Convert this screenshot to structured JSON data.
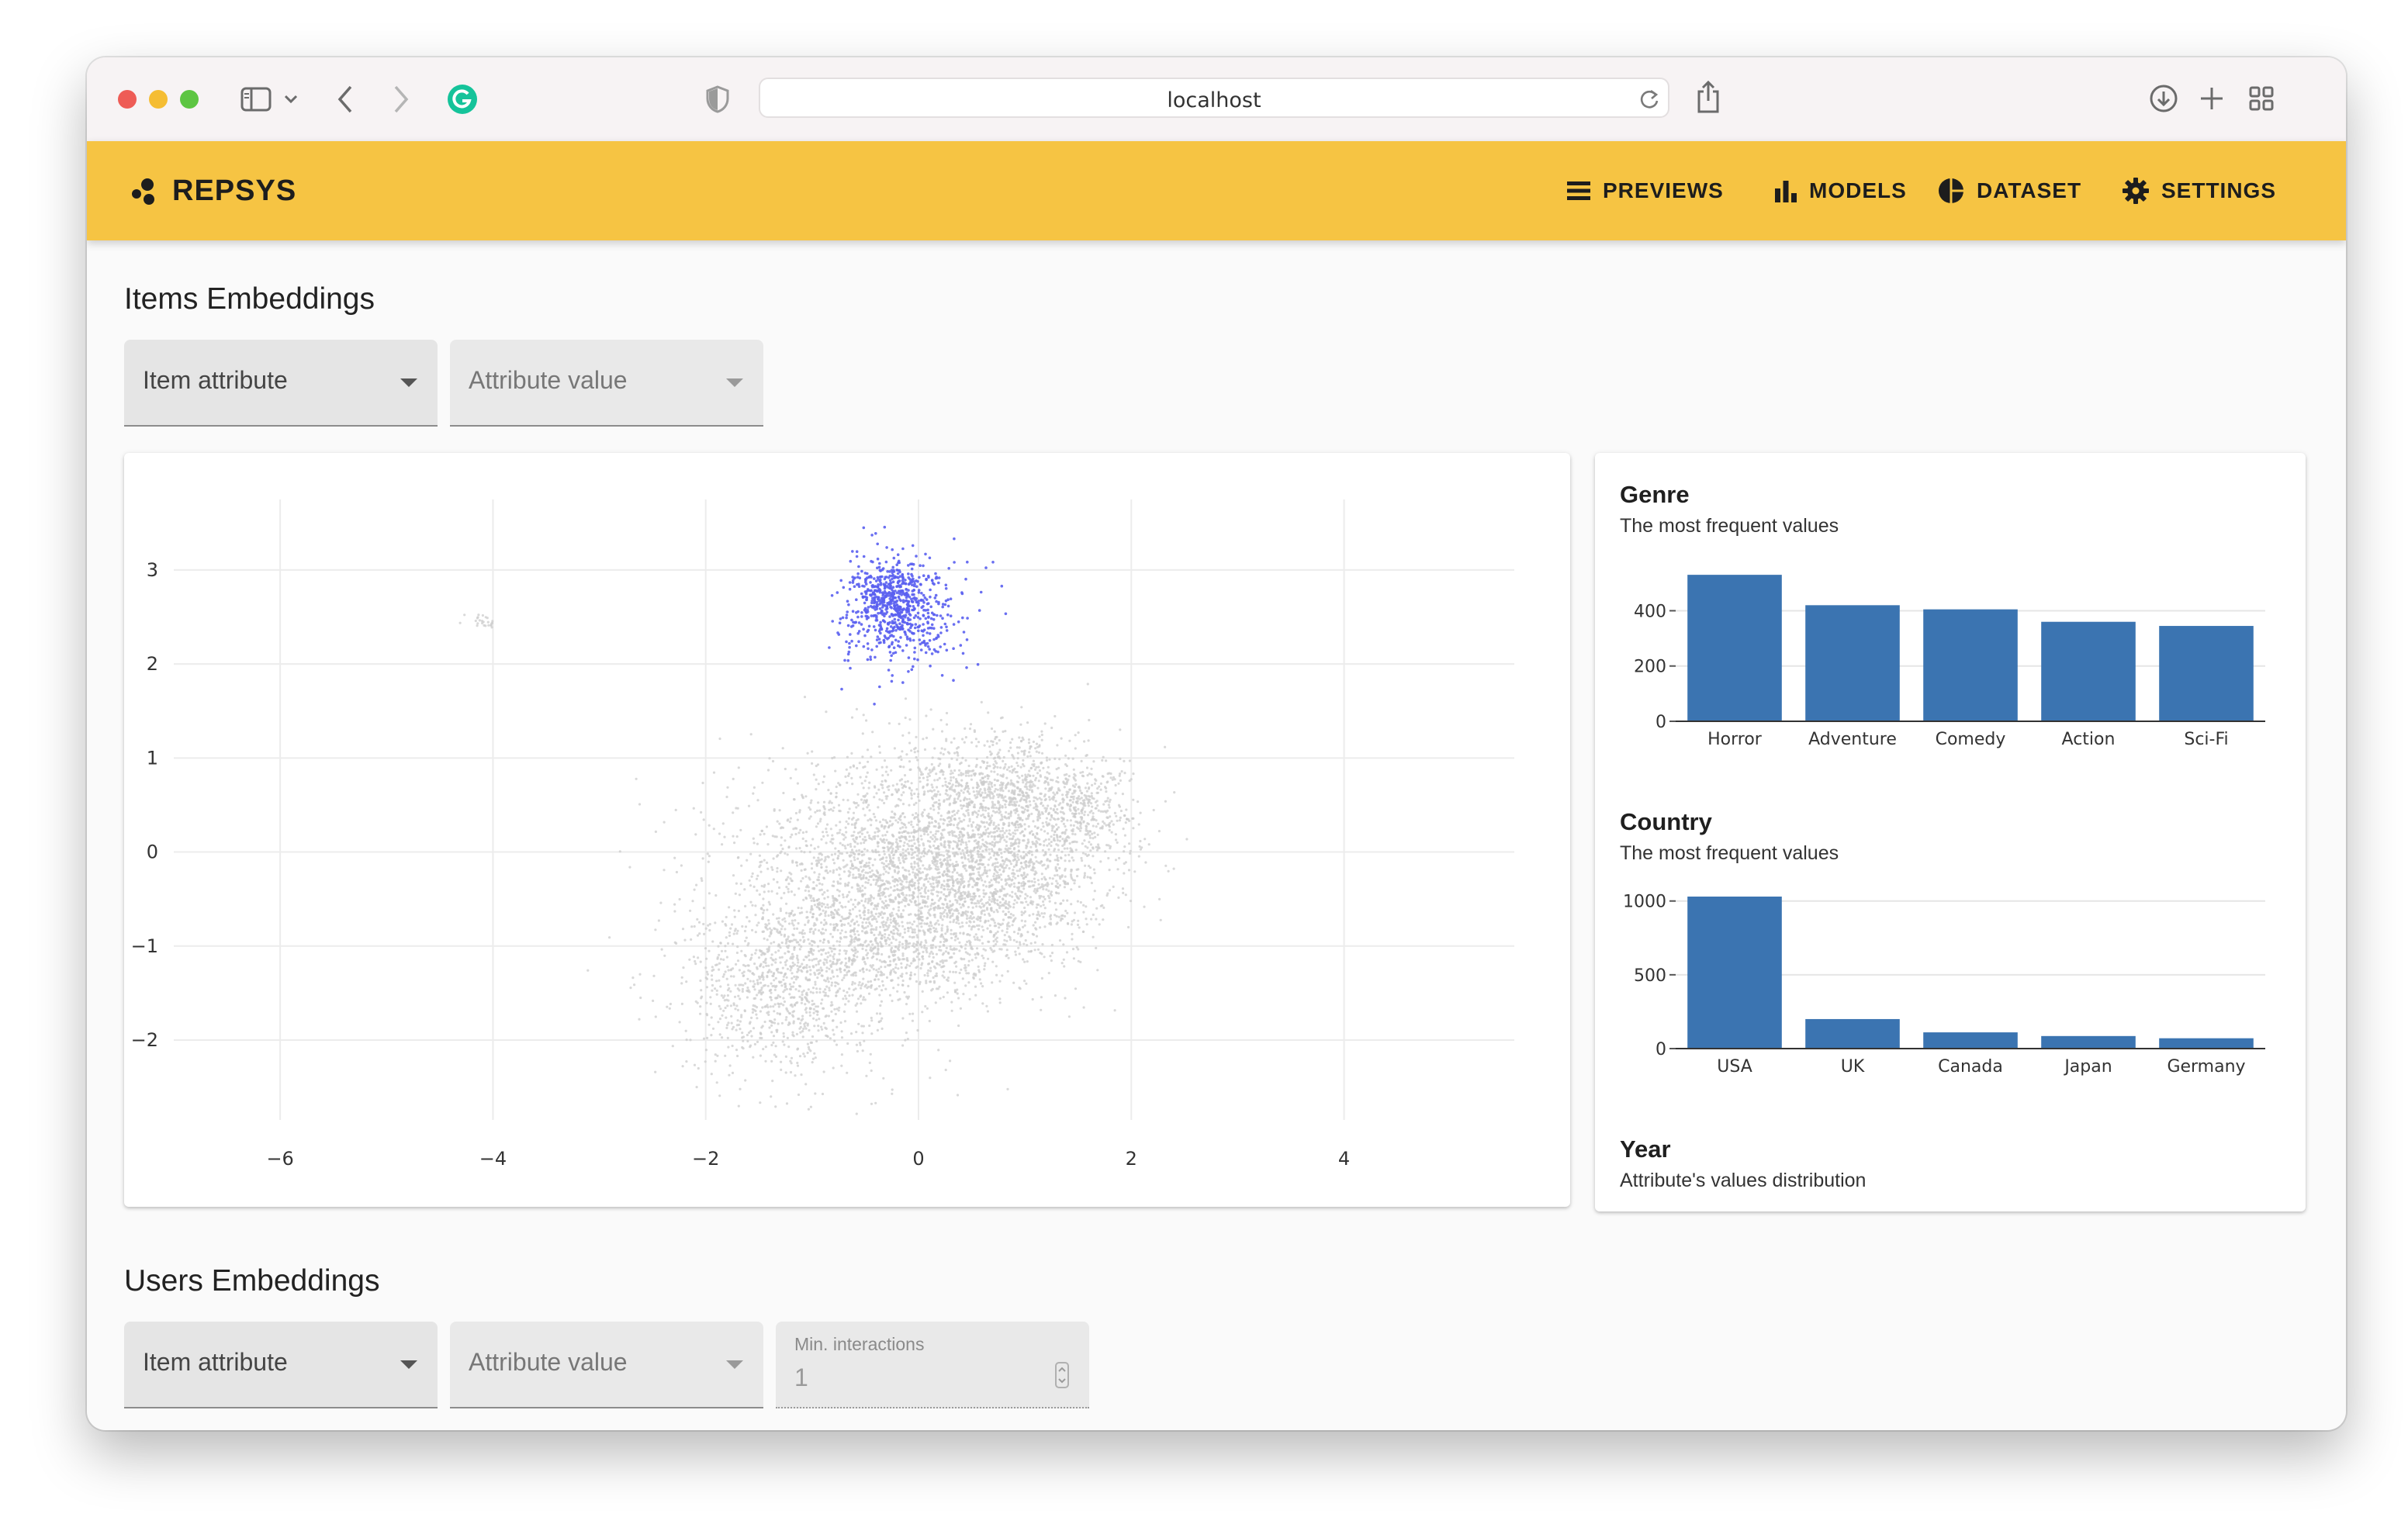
{
  "browser": {
    "url": "localhost"
  },
  "app": {
    "brand": "REPSYS",
    "nav": [
      {
        "label": "PREVIEWS",
        "icon": "list-icon"
      },
      {
        "label": "MODELS",
        "icon": "bar-chart-icon"
      },
      {
        "label": "DATASET",
        "icon": "pie-chart-icon"
      },
      {
        "label": "SETTINGS",
        "icon": "gear-icon"
      }
    ]
  },
  "items_section": {
    "title": "Items Embeddings",
    "select_attribute": "Item attribute",
    "select_value": "Attribute value"
  },
  "users_section": {
    "title": "Users Embeddings",
    "select_attribute": "Item attribute",
    "select_value": "Attribute value",
    "min_interactions_label": "Min. interactions",
    "min_interactions_value": "1"
  },
  "side_panel": {
    "genre_title": "Genre",
    "genre_sub": "The most frequent values",
    "country_title": "Country",
    "country_sub": "The most frequent values",
    "year_title": "Year",
    "year_sub": "Attribute's values distribution"
  },
  "chart_data": [
    {
      "type": "scatter",
      "title": "",
      "xlim": [
        -7,
        5.6
      ],
      "ylim": [
        -2.85,
        3.75
      ],
      "x_ticks": [
        -6,
        -4,
        -2,
        0,
        2,
        4
      ],
      "y_ticks": [
        -2,
        -1,
        0,
        1,
        2,
        3
      ],
      "x_tick_labels": [
        "−6",
        "−4",
        "−2",
        "0",
        "2",
        "4"
      ],
      "y_tick_labels": [
        "−2",
        "−1",
        "0",
        "1",
        "2",
        "3"
      ],
      "grid": true,
      "series": [
        {
          "color": "#cccccc",
          "description_points": "dense cloud roughly x -2.2..2.1, y -2.3..1.4, plus small cluster near (-4.1, 2.45)"
        },
        {
          "color": "#5a5ff0",
          "description_points": "highlighted cluster roughly x -1.0..0.9, y 1.8..3.3 centered near (-0.25, 2.7)"
        }
      ],
      "gray_clusters": [
        {
          "cx": 0.6,
          "cy": -0.1,
          "sx": 0.6,
          "sy": 0.55,
          "n": 2200
        },
        {
          "cx": -0.4,
          "cy": -0.3,
          "sx": 0.75,
          "sy": 0.65,
          "n": 1700
        },
        {
          "cx": -1.3,
          "cy": -1.45,
          "sx": 0.45,
          "sy": 0.45,
          "n": 900
        },
        {
          "cx": 0.8,
          "cy": 0.75,
          "sx": 0.4,
          "sy": 0.3,
          "n": 500
        },
        {
          "cx": 1.55,
          "cy": 0.45,
          "sx": 0.25,
          "sy": 0.25,
          "n": 300
        },
        {
          "cx": -0.2,
          "cy": -1.0,
          "sx": 0.5,
          "sy": 0.3,
          "n": 500
        },
        {
          "cx": -4.1,
          "cy": 2.45,
          "sx": 0.07,
          "sy": 0.04,
          "n": 25
        }
      ],
      "blue_clusters": [
        {
          "cx": -0.25,
          "cy": 2.7,
          "sx": 0.16,
          "sy": 0.2,
          "n": 420
        },
        {
          "cx": -0.15,
          "cy": 2.5,
          "sx": 0.3,
          "sy": 0.3,
          "n": 380
        }
      ]
    },
    {
      "type": "bar",
      "title": "Genre",
      "categories": [
        "Horror",
        "Adventure",
        "Comedy",
        "Action",
        "Sci-Fi"
      ],
      "values": [
        530,
        420,
        405,
        360,
        345
      ],
      "ylim": [
        0,
        550
      ],
      "y_ticks": [
        0,
        200,
        400
      ],
      "color": "#3b74b1",
      "grid": true
    },
    {
      "type": "bar",
      "title": "Country",
      "categories": [
        "USA",
        "UK",
        "Canada",
        "Japan",
        "Germany"
      ],
      "values": [
        1030,
        200,
        110,
        85,
        70
      ],
      "ylim": [
        0,
        1030
      ],
      "y_ticks": [
        0,
        500,
        1000
      ],
      "color": "#3b74b1",
      "grid": true
    }
  ]
}
